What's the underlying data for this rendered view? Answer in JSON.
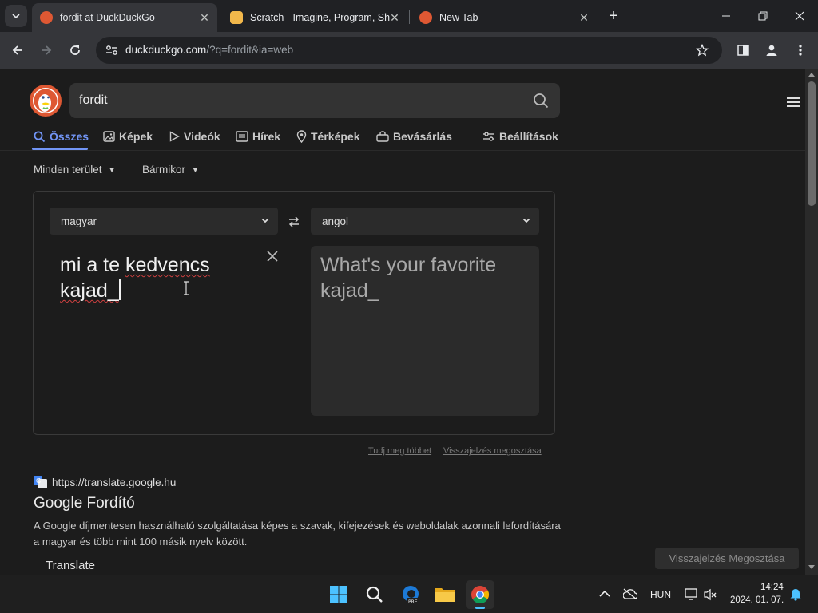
{
  "browser": {
    "tabs": [
      {
        "title": "fordit at DuckDuckGo",
        "active": true
      },
      {
        "title": "Scratch - Imagine, Program, Sha",
        "active": false
      },
      {
        "title": "New Tab",
        "active": false
      }
    ],
    "url_host": "duckduckgo.com",
    "url_rest": "/?q=fordit&ia=web"
  },
  "search": {
    "query": "fordit"
  },
  "nav_tabs": {
    "all": "Összes",
    "images": "Képek",
    "videos": "Videók",
    "news": "Hírek",
    "maps": "Térképek",
    "shopping": "Bevásárlás",
    "settings": "Beállítások"
  },
  "filters": {
    "region": "Minden terület",
    "time": "Bármikor"
  },
  "translator": {
    "source_lang": "magyar",
    "target_lang": "angol",
    "source_part1": "mi a  te ",
    "source_word": "kedvencs",
    "source_word2": "kajad_",
    "target_text": "What's your favorite kajad_",
    "learn_more": "Tudj meg többet",
    "share_feedback": "Visszajelzés megosztása"
  },
  "result": {
    "source_url": "https://translate.google.hu",
    "title": "Google Fordító",
    "description": "A Google díjmentesen használható szolgáltatása képes a szavak, kifejezések és weboldalak azonnali lefordítására a magyar és több mint 100 másik nyelv között.",
    "sublink": "Translate"
  },
  "feedback_button": "Visszajelzés Megosztása",
  "taskbar": {
    "language": "HUN",
    "time": "14:24",
    "date": "2024. 01. 07."
  },
  "colors": {
    "accent": "#7295f6",
    "ddg_orange": "#de5833"
  }
}
